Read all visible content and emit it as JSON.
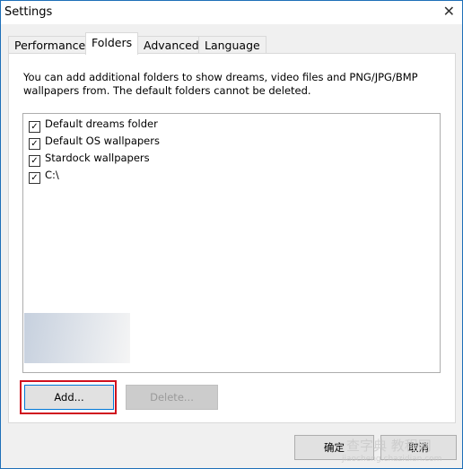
{
  "window": {
    "title": "Settings",
    "close_icon": "close-icon"
  },
  "tabs": [
    {
      "label": "Performance"
    },
    {
      "label": "Folders",
      "active": true
    },
    {
      "label": "Advanced"
    },
    {
      "label": "Language"
    }
  ],
  "folders": {
    "description": "You can add additional folders to show dreams, video files and PNG/JPG/BMP wallpapers from.  The default folders cannot be deleted.",
    "items": [
      {
        "label": "Default dreams folder",
        "checked": true
      },
      {
        "label": "Default OS wallpapers",
        "checked": true
      },
      {
        "label": "Stardock wallpapers",
        "checked": true
      },
      {
        "label": "C:\\",
        "checked": true
      }
    ],
    "add_label": "Add...",
    "delete_label": "Delete...",
    "highlight_color": "#d0101e"
  },
  "footer": {
    "ok_label": "确定",
    "cancel_label": "取消"
  },
  "watermark": {
    "text": "查字典 教程网",
    "url": "jiaocheng.chazidian.com"
  }
}
